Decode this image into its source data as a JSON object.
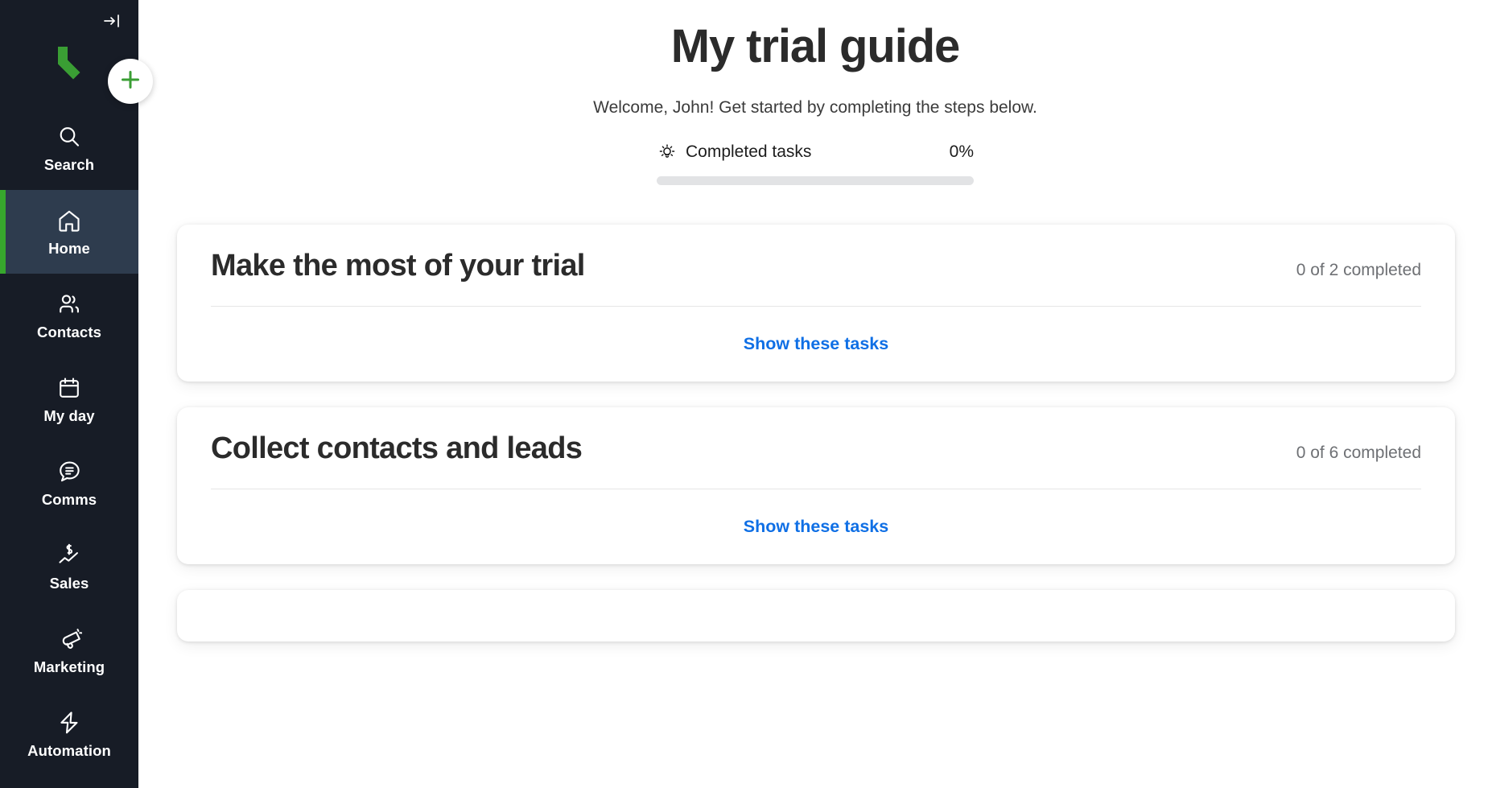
{
  "sidebar": {
    "collapse_icon": "collapse-panel-icon",
    "logo_icon": "keap-logo-icon",
    "add_button_icon": "plus-icon",
    "accent_color": "#37a72d",
    "background_color": "#171c26",
    "active_background_color": "#2e3c4e",
    "items": [
      {
        "label": "Search",
        "icon": "search-icon",
        "active": false
      },
      {
        "label": "Home",
        "icon": "home-icon",
        "active": true
      },
      {
        "label": "Contacts",
        "icon": "contacts-icon",
        "active": false
      },
      {
        "label": "My day",
        "icon": "calendar-icon",
        "active": false
      },
      {
        "label": "Comms",
        "icon": "chat-bubble-icon",
        "active": false
      },
      {
        "label": "Sales",
        "icon": "sales-chart-icon",
        "active": false
      },
      {
        "label": "Marketing",
        "icon": "megaphone-icon",
        "active": false
      },
      {
        "label": "Automation",
        "icon": "lightning-icon",
        "active": false
      }
    ]
  },
  "main": {
    "title": "My trial guide",
    "subtitle": "Welcome, John! Get started by completing the steps below.",
    "progress": {
      "icon": "lightbulb-icon",
      "label": "Completed tasks",
      "percent_text": "0%",
      "percent_value": 0
    },
    "cards": [
      {
        "title": "Make the most of your trial",
        "count_text": "0 of 2 completed",
        "action_label": "Show these tasks"
      },
      {
        "title": "Collect contacts and leads",
        "count_text": "0 of 6 completed",
        "action_label": "Show these tasks"
      },
      {
        "title": "",
        "count_text": "",
        "action_label": ""
      }
    ]
  }
}
